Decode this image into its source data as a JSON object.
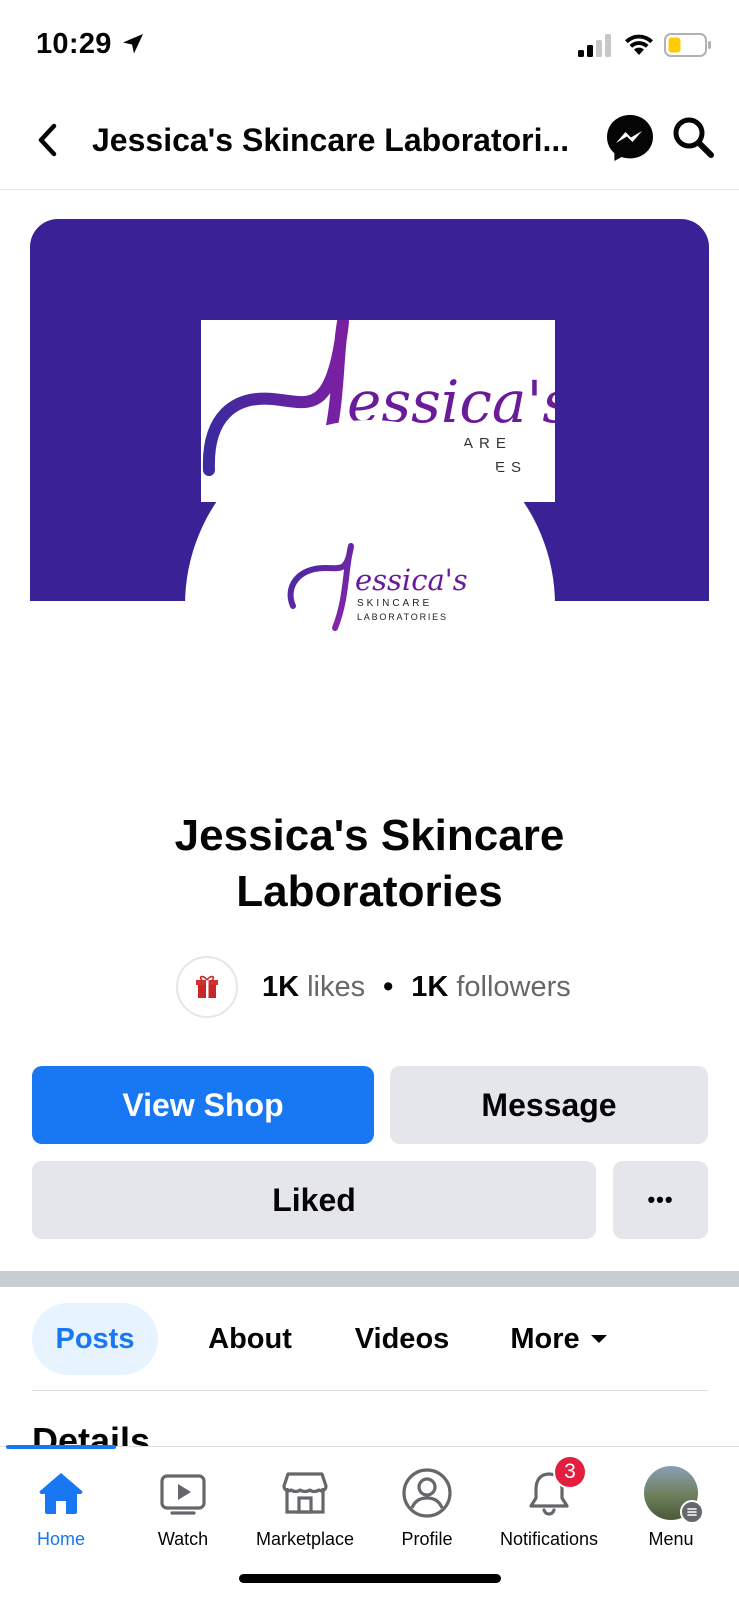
{
  "status_bar": {
    "time": "10:29"
  },
  "header": {
    "title": "Jessica's Skincare Laboratori..."
  },
  "cover": {
    "logo_text": "essica's",
    "logo_letter": "J",
    "logo_line_1": "ARE",
    "logo_line_2": "ES"
  },
  "profile_logo": {
    "letter": "J",
    "name": "essica's",
    "line_1": "SKINCARE",
    "line_2": "LABORATORIES"
  },
  "page": {
    "name_line_1": "Jessica's Skincare",
    "name_line_2": "Laboratories",
    "likes_count": "1K",
    "likes_label": "likes",
    "separator": "•",
    "followers_count": "1K",
    "followers_label": "followers"
  },
  "actions": {
    "view_shop": "View Shop",
    "message": "Message",
    "liked": "Liked",
    "more": "•••"
  },
  "tabs": [
    {
      "label": "Posts",
      "active": true
    },
    {
      "label": "About",
      "active": false
    },
    {
      "label": "Videos",
      "active": false
    },
    {
      "label": "More",
      "active": false
    }
  ],
  "section": {
    "heading": "Details"
  },
  "bottom_nav": [
    {
      "label": "Home",
      "icon": "home-icon",
      "active": true
    },
    {
      "label": "Watch",
      "icon": "watch-icon",
      "active": false
    },
    {
      "label": "Marketplace",
      "icon": "marketplace-icon",
      "active": false
    },
    {
      "label": "Profile",
      "icon": "profile-icon",
      "active": false
    },
    {
      "label": "Notifications",
      "icon": "bell-icon",
      "active": false,
      "badge": "3"
    },
    {
      "label": "Menu",
      "icon": "menu-avatar",
      "active": false
    }
  ],
  "colors": {
    "brand_blue": "#1877f2",
    "cover_purple": "#3a2196",
    "logo_purple": "#6a1b9a",
    "badge_red": "#e41e3f"
  }
}
